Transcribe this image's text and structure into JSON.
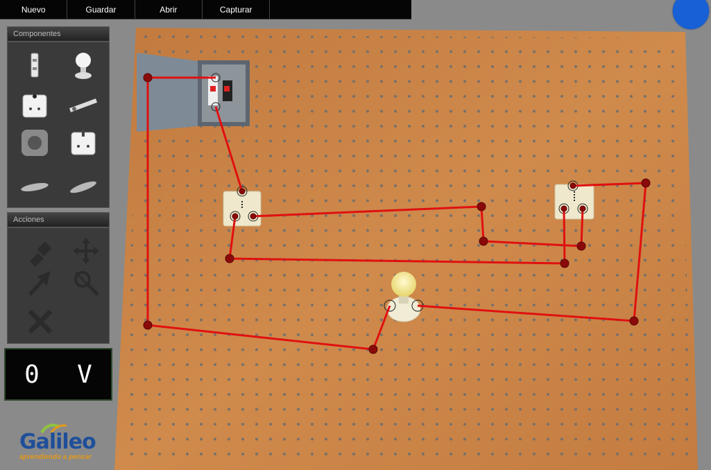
{
  "menu": {
    "items": [
      "Nuevo",
      "Guardar",
      "Abrir",
      "Capturar"
    ]
  },
  "panels": {
    "components_title": "Componentes",
    "actions_title": "Acciones"
  },
  "components": [
    {
      "name": "fuse-component-icon"
    },
    {
      "name": "lamp-component-icon"
    },
    {
      "name": "single-switch-component-icon"
    },
    {
      "name": "resistor-component-icon"
    },
    {
      "name": "socket-component-icon"
    },
    {
      "name": "double-switch-component-icon"
    },
    {
      "name": "wire-component-icon"
    },
    {
      "name": "cable-component-icon"
    }
  ],
  "actions": [
    {
      "name": "plug-icon"
    },
    {
      "name": "move-arrows-icon"
    },
    {
      "name": "pointer-icon"
    },
    {
      "name": "magnifier-icon"
    },
    {
      "name": "delete-x-icon"
    }
  ],
  "voltmeter": {
    "value": "0",
    "unit": "V"
  },
  "logo": {
    "word": "Galileo",
    "tagline": "aprendiendo a pensar"
  },
  "colors": {
    "board": "#c97f44",
    "wire": "#e01010",
    "node": "#8a0a0a",
    "status_light": "#1760d6"
  }
}
